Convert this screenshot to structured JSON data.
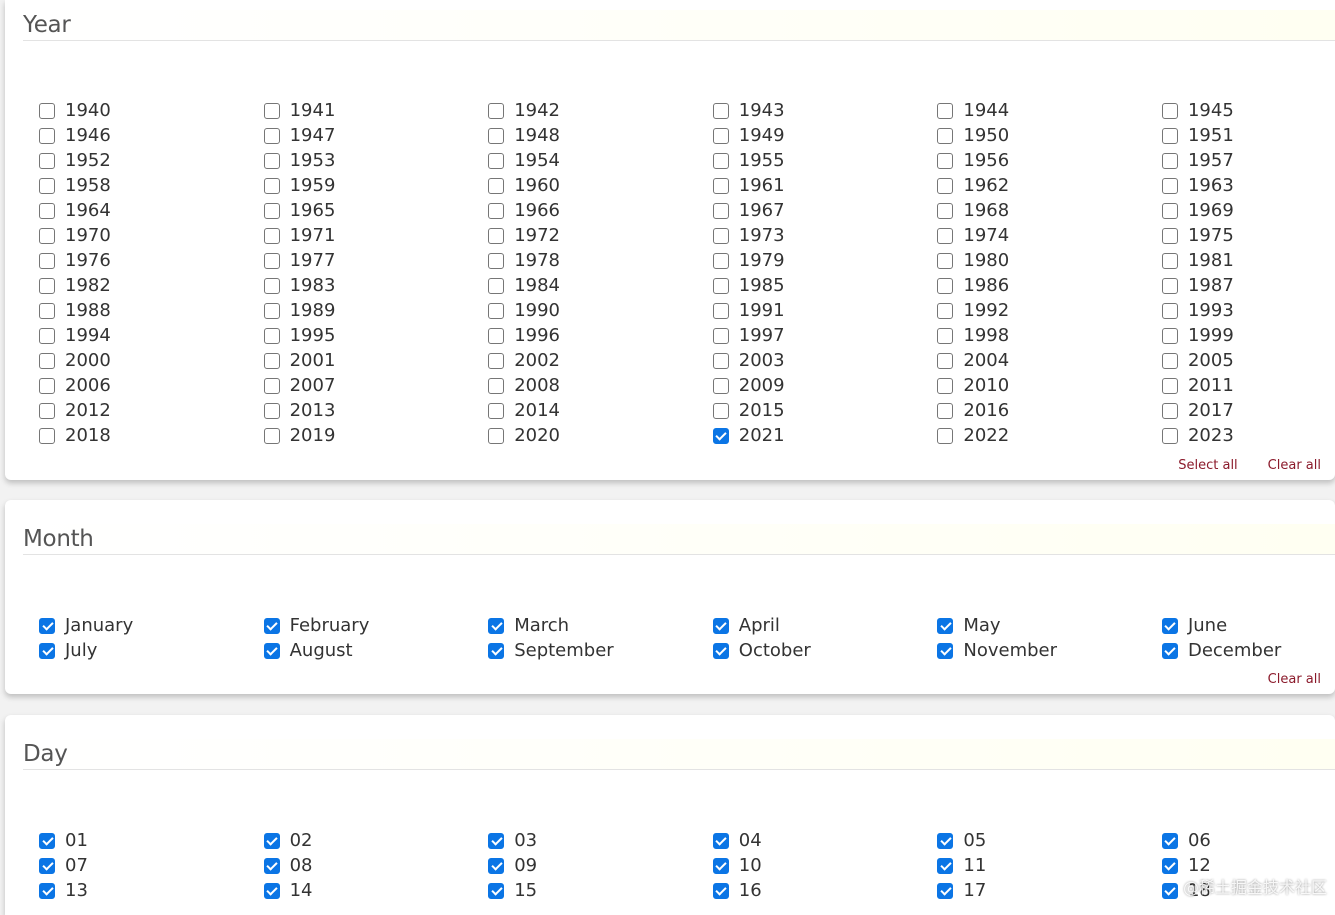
{
  "year": {
    "title": "Year",
    "options": [
      {
        "label": "1940",
        "checked": false
      },
      {
        "label": "1941",
        "checked": false
      },
      {
        "label": "1942",
        "checked": false
      },
      {
        "label": "1943",
        "checked": false
      },
      {
        "label": "1944",
        "checked": false
      },
      {
        "label": "1945",
        "checked": false
      },
      {
        "label": "1946",
        "checked": false
      },
      {
        "label": "1947",
        "checked": false
      },
      {
        "label": "1948",
        "checked": false
      },
      {
        "label": "1949",
        "checked": false
      },
      {
        "label": "1950",
        "checked": false
      },
      {
        "label": "1951",
        "checked": false
      },
      {
        "label": "1952",
        "checked": false
      },
      {
        "label": "1953",
        "checked": false
      },
      {
        "label": "1954",
        "checked": false
      },
      {
        "label": "1955",
        "checked": false
      },
      {
        "label": "1956",
        "checked": false
      },
      {
        "label": "1957",
        "checked": false
      },
      {
        "label": "1958",
        "checked": false
      },
      {
        "label": "1959",
        "checked": false
      },
      {
        "label": "1960",
        "checked": false
      },
      {
        "label": "1961",
        "checked": false
      },
      {
        "label": "1962",
        "checked": false
      },
      {
        "label": "1963",
        "checked": false
      },
      {
        "label": "1964",
        "checked": false
      },
      {
        "label": "1965",
        "checked": false
      },
      {
        "label": "1966",
        "checked": false
      },
      {
        "label": "1967",
        "checked": false
      },
      {
        "label": "1968",
        "checked": false
      },
      {
        "label": "1969",
        "checked": false
      },
      {
        "label": "1970",
        "checked": false
      },
      {
        "label": "1971",
        "checked": false
      },
      {
        "label": "1972",
        "checked": false
      },
      {
        "label": "1973",
        "checked": false
      },
      {
        "label": "1974",
        "checked": false
      },
      {
        "label": "1975",
        "checked": false
      },
      {
        "label": "1976",
        "checked": false
      },
      {
        "label": "1977",
        "checked": false
      },
      {
        "label": "1978",
        "checked": false
      },
      {
        "label": "1979",
        "checked": false
      },
      {
        "label": "1980",
        "checked": false
      },
      {
        "label": "1981",
        "checked": false
      },
      {
        "label": "1982",
        "checked": false
      },
      {
        "label": "1983",
        "checked": false
      },
      {
        "label": "1984",
        "checked": false
      },
      {
        "label": "1985",
        "checked": false
      },
      {
        "label": "1986",
        "checked": false
      },
      {
        "label": "1987",
        "checked": false
      },
      {
        "label": "1988",
        "checked": false
      },
      {
        "label": "1989",
        "checked": false
      },
      {
        "label": "1990",
        "checked": false
      },
      {
        "label": "1991",
        "checked": false
      },
      {
        "label": "1992",
        "checked": false
      },
      {
        "label": "1993",
        "checked": false
      },
      {
        "label": "1994",
        "checked": false
      },
      {
        "label": "1995",
        "checked": false
      },
      {
        "label": "1996",
        "checked": false
      },
      {
        "label": "1997",
        "checked": false
      },
      {
        "label": "1998",
        "checked": false
      },
      {
        "label": "1999",
        "checked": false
      },
      {
        "label": "2000",
        "checked": false
      },
      {
        "label": "2001",
        "checked": false
      },
      {
        "label": "2002",
        "checked": false
      },
      {
        "label": "2003",
        "checked": false
      },
      {
        "label": "2004",
        "checked": false
      },
      {
        "label": "2005",
        "checked": false
      },
      {
        "label": "2006",
        "checked": false
      },
      {
        "label": "2007",
        "checked": false
      },
      {
        "label": "2008",
        "checked": false
      },
      {
        "label": "2009",
        "checked": false
      },
      {
        "label": "2010",
        "checked": false
      },
      {
        "label": "2011",
        "checked": false
      },
      {
        "label": "2012",
        "checked": false
      },
      {
        "label": "2013",
        "checked": false
      },
      {
        "label": "2014",
        "checked": false
      },
      {
        "label": "2015",
        "checked": false
      },
      {
        "label": "2016",
        "checked": false
      },
      {
        "label": "2017",
        "checked": false
      },
      {
        "label": "2018",
        "checked": false
      },
      {
        "label": "2019",
        "checked": false
      },
      {
        "label": "2020",
        "checked": false
      },
      {
        "label": "2021",
        "checked": true
      },
      {
        "label": "2022",
        "checked": false
      },
      {
        "label": "2023",
        "checked": false
      }
    ],
    "select_all_label": "Select all",
    "clear_all_label": "Clear all"
  },
  "month": {
    "title": "Month",
    "options": [
      {
        "label": "January",
        "checked": true
      },
      {
        "label": "February",
        "checked": true
      },
      {
        "label": "March",
        "checked": true
      },
      {
        "label": "April",
        "checked": true
      },
      {
        "label": "May",
        "checked": true
      },
      {
        "label": "June",
        "checked": true
      },
      {
        "label": "July",
        "checked": true
      },
      {
        "label": "August",
        "checked": true
      },
      {
        "label": "September",
        "checked": true
      },
      {
        "label": "October",
        "checked": true
      },
      {
        "label": "November",
        "checked": true
      },
      {
        "label": "December",
        "checked": true
      }
    ],
    "clear_all_label": "Clear all"
  },
  "day": {
    "title": "Day",
    "options": [
      {
        "label": "01",
        "checked": true
      },
      {
        "label": "02",
        "checked": true
      },
      {
        "label": "03",
        "checked": true
      },
      {
        "label": "04",
        "checked": true
      },
      {
        "label": "05",
        "checked": true
      },
      {
        "label": "06",
        "checked": true
      },
      {
        "label": "07",
        "checked": true
      },
      {
        "label": "08",
        "checked": true
      },
      {
        "label": "09",
        "checked": true
      },
      {
        "label": "10",
        "checked": true
      },
      {
        "label": "11",
        "checked": true
      },
      {
        "label": "12",
        "checked": true
      },
      {
        "label": "13",
        "checked": true
      },
      {
        "label": "14",
        "checked": true
      },
      {
        "label": "15",
        "checked": true
      },
      {
        "label": "16",
        "checked": true
      },
      {
        "label": "17",
        "checked": true
      },
      {
        "label": "18",
        "checked": true
      }
    ]
  },
  "watermark": "@稀土掘金技术社区",
  "colors": {
    "checkbox_checked": "#0b75e5",
    "action_link": "#8b1a2b",
    "title_text": "#555555"
  }
}
